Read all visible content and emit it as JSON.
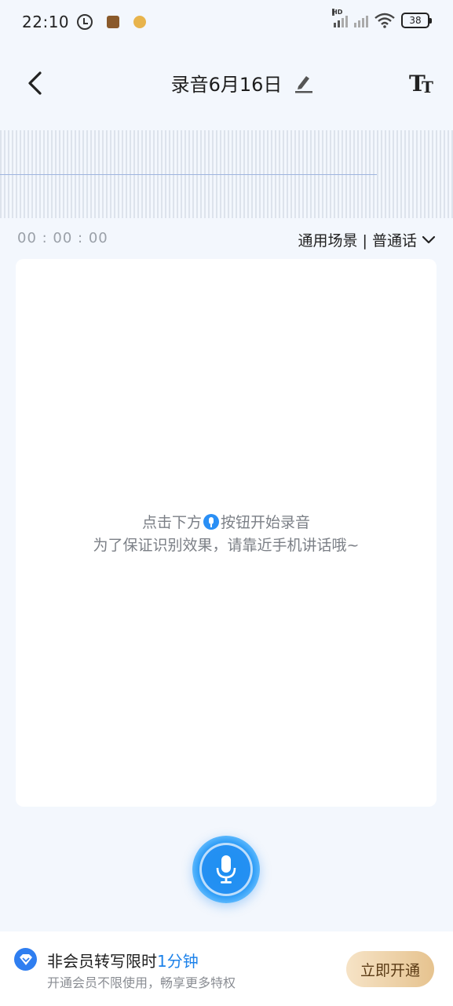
{
  "status_bar": {
    "time": "22:10",
    "battery": "38",
    "hd_label": "HD"
  },
  "header": {
    "title": "录音6月16日",
    "font_size_label": "TT"
  },
  "recorder": {
    "timer": "00 : 00 : 00",
    "scene": "通用场景 | 普通话"
  },
  "transcript": {
    "hint_before_icon": "点击下方",
    "hint_after_icon": "按钮开始录音",
    "hint_line2": "为了保证识别效果，请靠近手机讲话哦~"
  },
  "membership": {
    "title_prefix": "非会员转写限时",
    "title_highlight": "1分钟",
    "subtitle": "开通会员不限使用，畅享更多特权",
    "button_label": "立即开通"
  },
  "colors": {
    "accent": "#1d82ea",
    "background": "#f3f7fd"
  }
}
